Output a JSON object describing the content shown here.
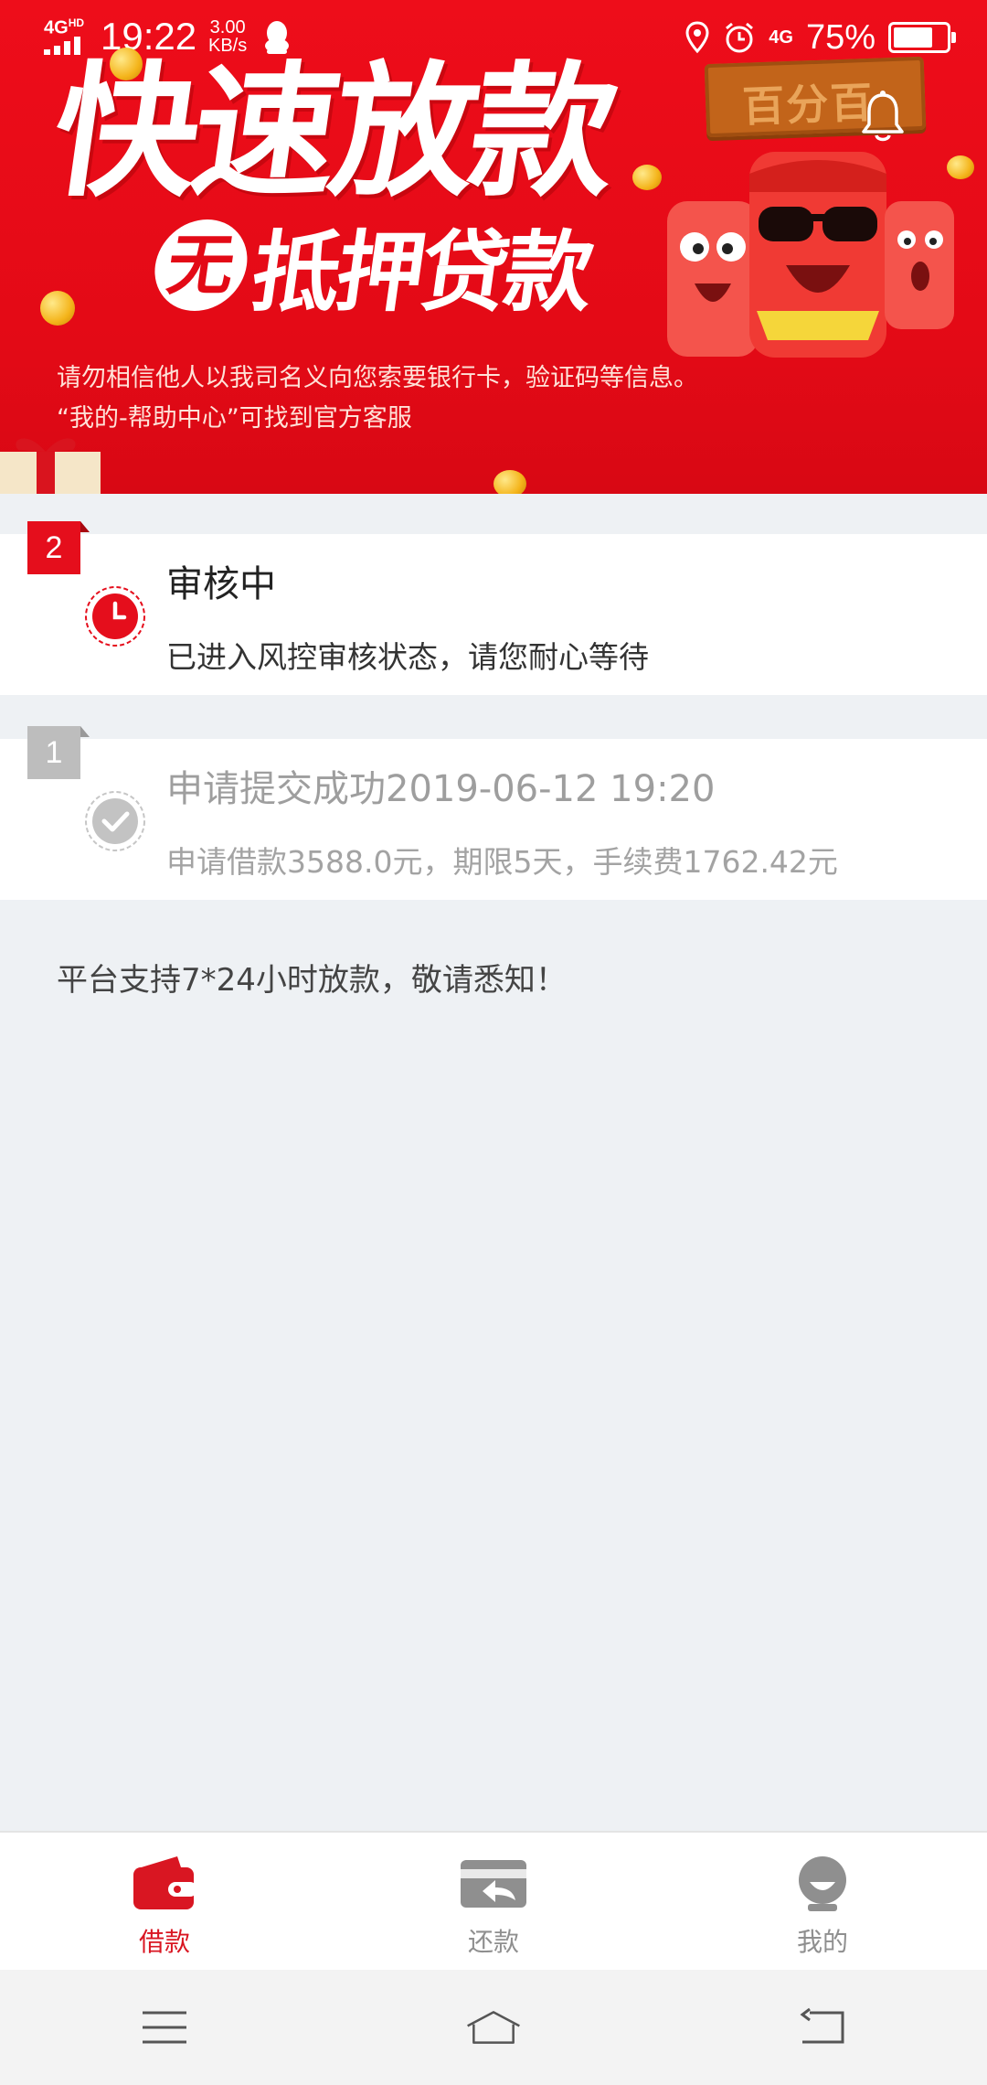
{
  "status_bar": {
    "network": "4G",
    "network_sup": "HD",
    "time": "19:22",
    "speed_value": "3.00",
    "speed_unit": "KB/s",
    "right_network": "4G",
    "battery_percent": "75%",
    "battery_level": 0.75,
    "icons": [
      "qq-icon",
      "location-icon",
      "alarm-icon",
      "battery-icon"
    ]
  },
  "banner": {
    "headline": "快速放款",
    "badge": "无",
    "sub_headline": "抵押贷款",
    "brand_sign": "百分百",
    "notice_line1": "请勿相信他人以我司名义向您索要银行卡，验证码等信息。",
    "notice_line2": "“我的-帮助中心”可找到官方客服"
  },
  "steps": [
    {
      "number": "2",
      "title": "审核中",
      "description": "已进入风控审核状态，请您耐心等待",
      "icon": "clock-icon",
      "active": true
    },
    {
      "number": "1",
      "title": "申请提交成功2019-06-12 19:20",
      "description": "申请借款3588.0元，期限5天，手续费1762.42元",
      "icon": "check-icon",
      "active": false
    }
  ],
  "tip": "平台支持7*24小时放款，敬请悉知！",
  "tabs": [
    {
      "label": "借款",
      "icon": "wallet-icon",
      "active": true
    },
    {
      "label": "还款",
      "icon": "card-return-icon",
      "active": false
    },
    {
      "label": "我的",
      "icon": "profile-icon",
      "active": false
    }
  ],
  "colors": {
    "brand_red": "#e30a16",
    "inactive_gray": "#8f8f8f",
    "page_bg": "#eef1f4"
  }
}
